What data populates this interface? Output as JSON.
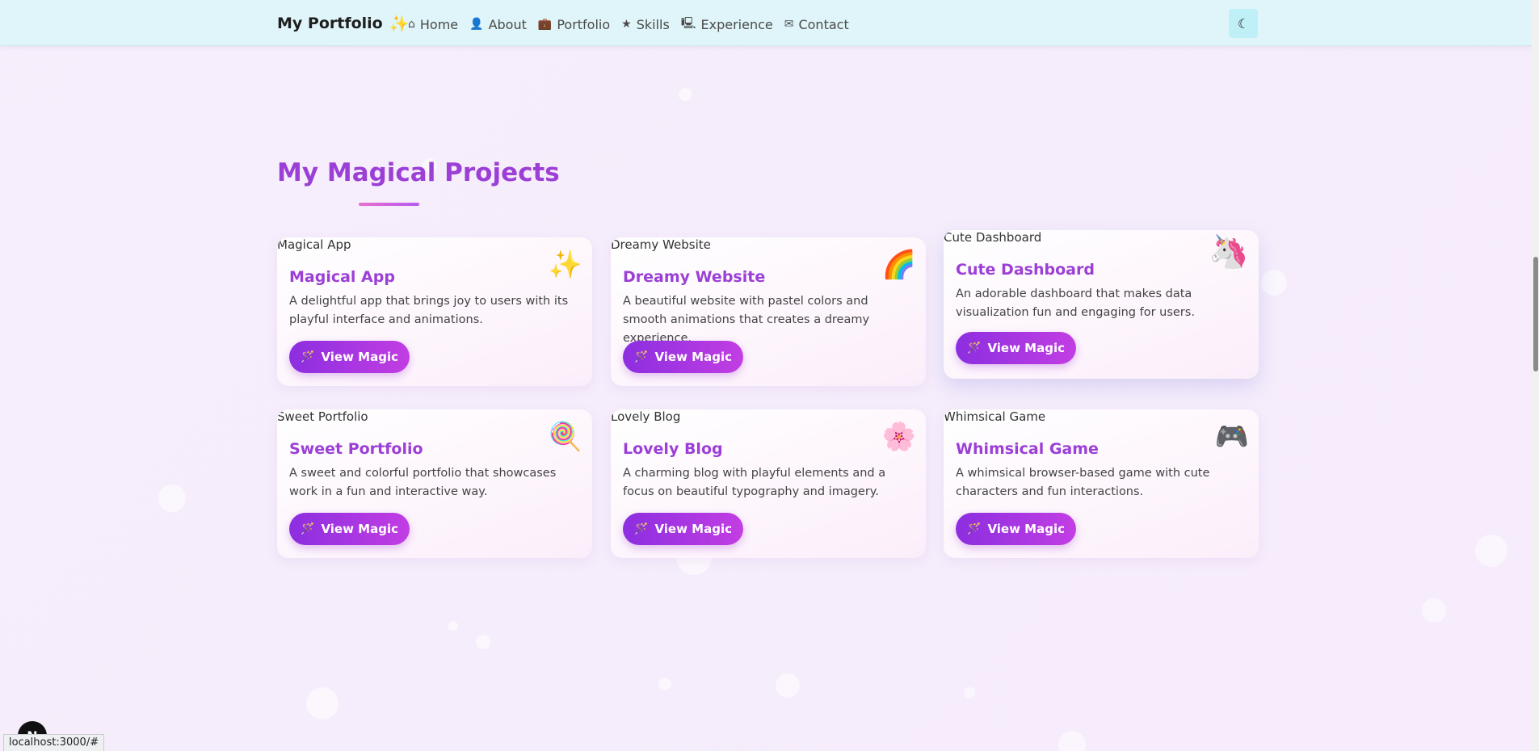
{
  "navbar": {
    "brand": "My Portfolio",
    "brand_icon": "sparkles-icon",
    "links": [
      {
        "label": "Home",
        "icon": "⌂"
      },
      {
        "label": "About",
        "icon": "👤"
      },
      {
        "label": "Portfolio",
        "icon": "💼"
      },
      {
        "label": "Skills",
        "icon": "★"
      },
      {
        "label": "Experience",
        "icon": "🖳"
      },
      {
        "label": "Contact",
        "icon": "✉"
      }
    ],
    "theme_toggle_icon": "moon-icon"
  },
  "section": {
    "title": "My Magical Projects"
  },
  "projects": [
    {
      "alt": "Magical App",
      "emoji": "✨",
      "title": "Magical App",
      "description": "A delightful app that brings joy to users with its playful interface and animations.",
      "button": "View Magic"
    },
    {
      "alt": "Dreamy Website",
      "emoji": "🌈",
      "title": "Dreamy Website",
      "description": "A beautiful website with pastel colors and smooth animations that creates a dreamy experience.",
      "button": "View Magic"
    },
    {
      "alt": "Cute Dashboard",
      "emoji": "🦄",
      "title": "Cute Dashboard",
      "description": "An adorable dashboard that makes data visualization fun and engaging for users.",
      "button": "View Magic"
    },
    {
      "alt": "Sweet Portfolio",
      "emoji": "🍭",
      "title": "Sweet Portfolio",
      "description": "A sweet and colorful portfolio that showcases work in a fun and interactive way.",
      "button": "View Magic"
    },
    {
      "alt": "Lovely Blog",
      "emoji": "🌸",
      "title": "Lovely Blog",
      "description": "A charming blog with playful elements and a focus on beautiful typography and imagery.",
      "button": "View Magic"
    },
    {
      "alt": "Whimsical Game",
      "emoji": "🎮",
      "title": "Whimsical Game",
      "description": "A whimsical browser-based game with cute characters and fun interactions.",
      "button": "View Magic"
    }
  ],
  "status_bar": {
    "url": "localhost:3000/#"
  },
  "colors": {
    "accent": "#9b3fd6",
    "button_start": "#8c2ee0",
    "button_end": "#c23ee3",
    "navbar_bg": "#e0f5f9",
    "page_bg": "#f6edfb"
  }
}
